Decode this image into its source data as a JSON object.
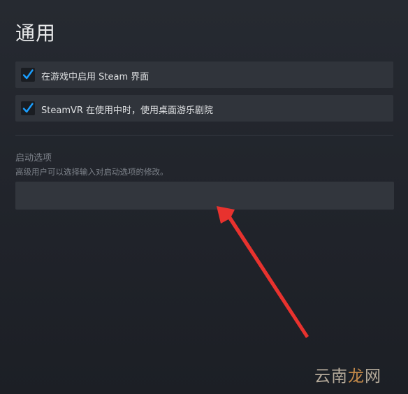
{
  "page": {
    "title": "通用"
  },
  "options": [
    {
      "label": "在游戏中启用 Steam 界面",
      "checked": true
    },
    {
      "label": "SteamVR 在使用中时，使用桌面游乐剧院",
      "checked": true
    }
  ],
  "launch_options": {
    "title": "启动选项",
    "description": "高级用户可以选择输入对启动选项的修改。",
    "value": ""
  },
  "watermark": {
    "part1": "云南",
    "part2": "龙",
    "part3": "网"
  },
  "colors": {
    "background": "#23262d",
    "row_background": "#30343b",
    "checkmark": "#1a9fff",
    "annotation_arrow": "#e8322e"
  },
  "icons": {
    "checkbox": "checkmark-icon",
    "annotation": "red-arrow-icon"
  }
}
